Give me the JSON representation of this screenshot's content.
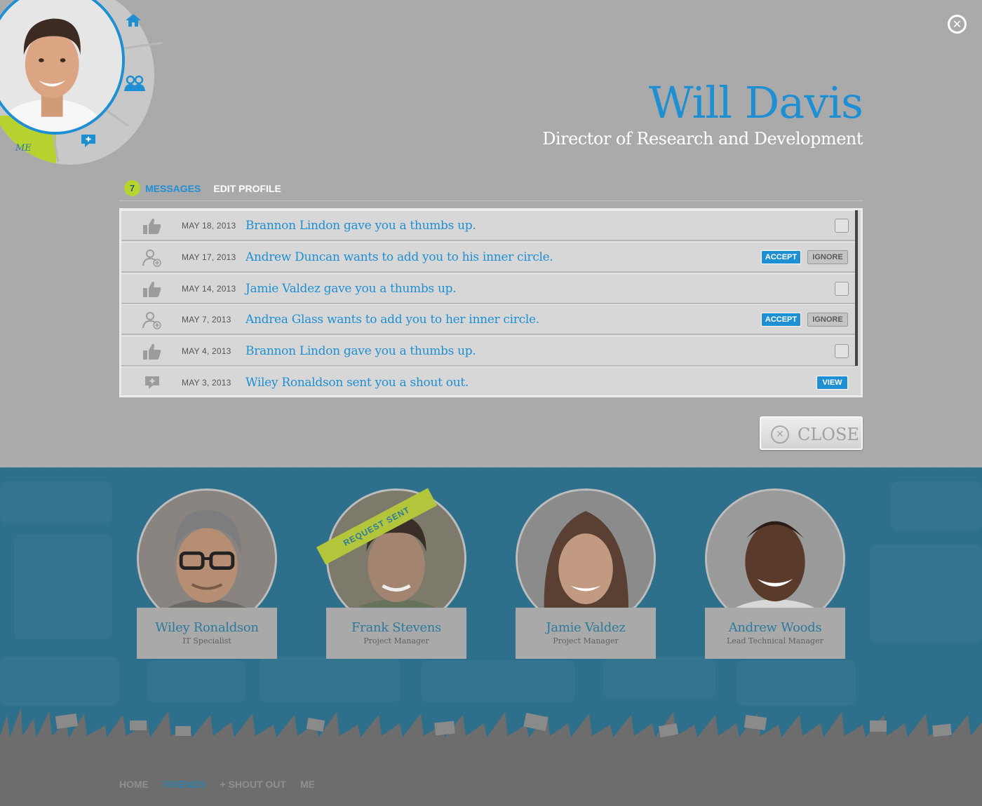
{
  "profile": {
    "name": "Will Davis",
    "title": "Director of Research and Development"
  },
  "radial_menu": {
    "me_label": "ME",
    "icons": [
      "home-icon",
      "friends-icon",
      "shout-out-icon"
    ]
  },
  "tabs": {
    "message_count": "7",
    "messages_label": "MESSAGES",
    "edit_profile_label": "EDIT PROFILE"
  },
  "messages": [
    {
      "icon": "thumbs-up-icon",
      "date": "MAY 18, 2013",
      "text": "Brannon Lindon gave you a thumbs up."
    },
    {
      "icon": "add-user-icon",
      "date": "MAY 17, 2013",
      "text": "Andrew Duncan wants to add you to his inner circle.",
      "accept": "ACCEPT",
      "ignore": "IGNORE"
    },
    {
      "icon": "thumbs-up-icon",
      "date": "MAY 14, 2013",
      "text": "Jamie Valdez gave you a thumbs up."
    },
    {
      "icon": "add-user-icon",
      "date": "MAY 7, 2013",
      "text": "Andrea Glass wants to add you to her inner circle.",
      "accept": "ACCEPT",
      "ignore": "IGNORE"
    },
    {
      "icon": "thumbs-up-icon",
      "date": "MAY 4, 2013",
      "text": "Brannon Lindon gave you a thumbs up."
    },
    {
      "icon": "shout-out-icon",
      "date": "MAY 3, 2013",
      "text": "Wiley Ronaldson sent you a shout out.",
      "view": "VIEW"
    }
  ],
  "close_label": "CLOSE",
  "friends": [
    {
      "name": "Wiley Ronaldson",
      "role": "IT Specialist"
    },
    {
      "name": "Frank Stevens",
      "role": "Project Manager",
      "badge": "REQUEST SENT"
    },
    {
      "name": "Jamie Valdez",
      "role": "Project Manager"
    },
    {
      "name": "Andrew Woods",
      "role": "Lead Technical Manager"
    }
  ],
  "footer_nav": {
    "home": "HOME",
    "friends": "FRIENDS",
    "shout_out": "+ SHOUT OUT",
    "me": "ME"
  },
  "colors": {
    "accent_blue": "#1f8fd3",
    "accent_green": "#b6d330",
    "panel_gray": "#a9a9a9",
    "teal_bg": "#2e6f8b"
  }
}
